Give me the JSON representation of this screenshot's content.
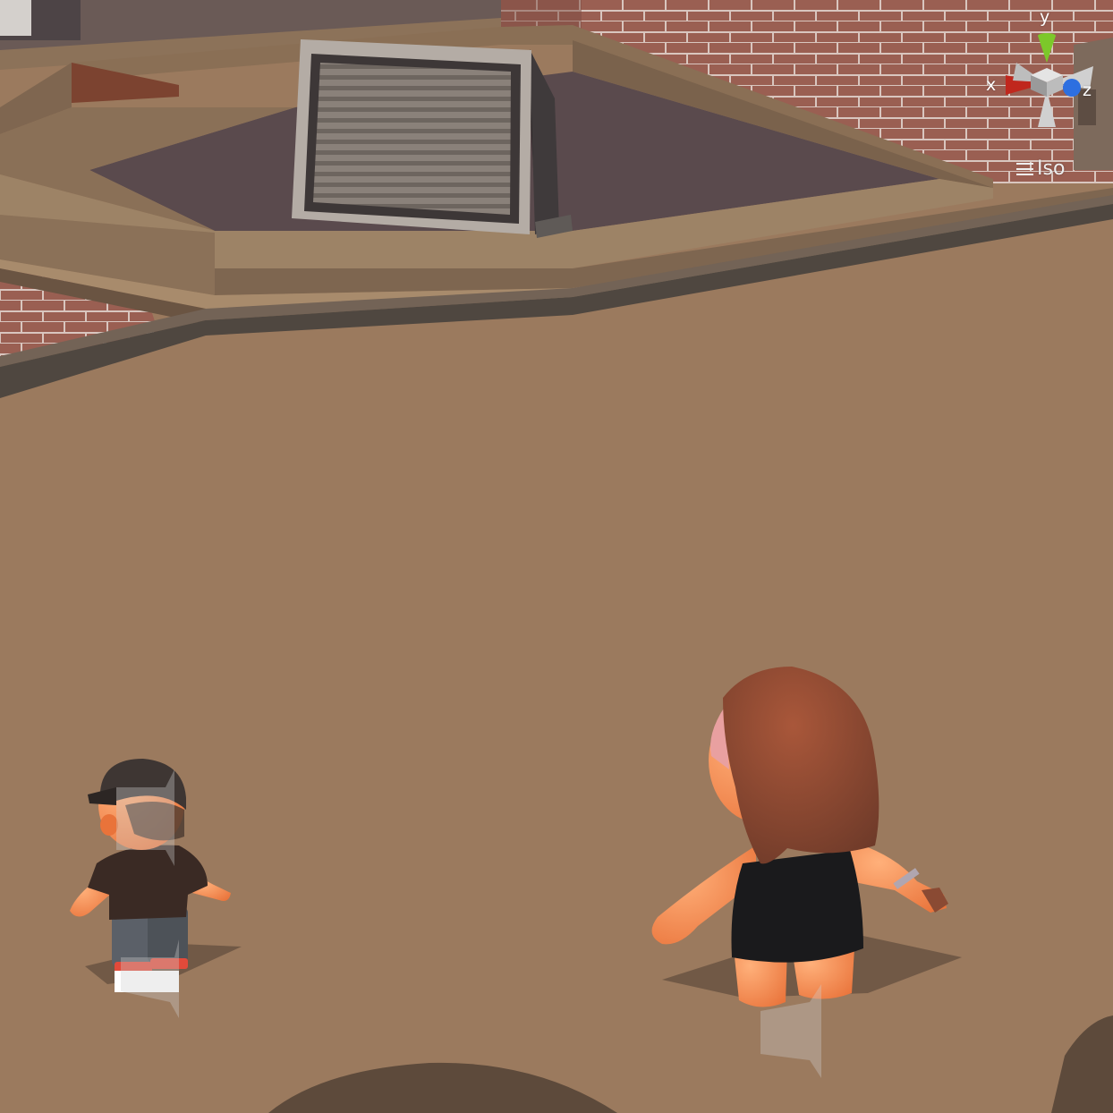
{
  "gizmo": {
    "x_label": "x",
    "y_label": "y",
    "z_label": "z",
    "projection": "Iso",
    "colors": {
      "x": "#c0271d",
      "y": "#7cc82a",
      "z": "#2d6fe0",
      "neutral": "#c8c8c8"
    }
  },
  "scene": {
    "colors": {
      "floor": "#9b7a5e",
      "brick": "#9a5f52",
      "roof": "#5a4a4d",
      "parapet": "#7e6650"
    }
  },
  "characters": [
    {
      "name": "boy-cap",
      "shirt": "#3a2a24",
      "pants": "#5b6068",
      "skin": "#f28f55"
    },
    {
      "name": "girl-long-hair",
      "dress": "#1a1a1c",
      "hair": "#8a4a33",
      "skin": "#f28f55"
    }
  ]
}
